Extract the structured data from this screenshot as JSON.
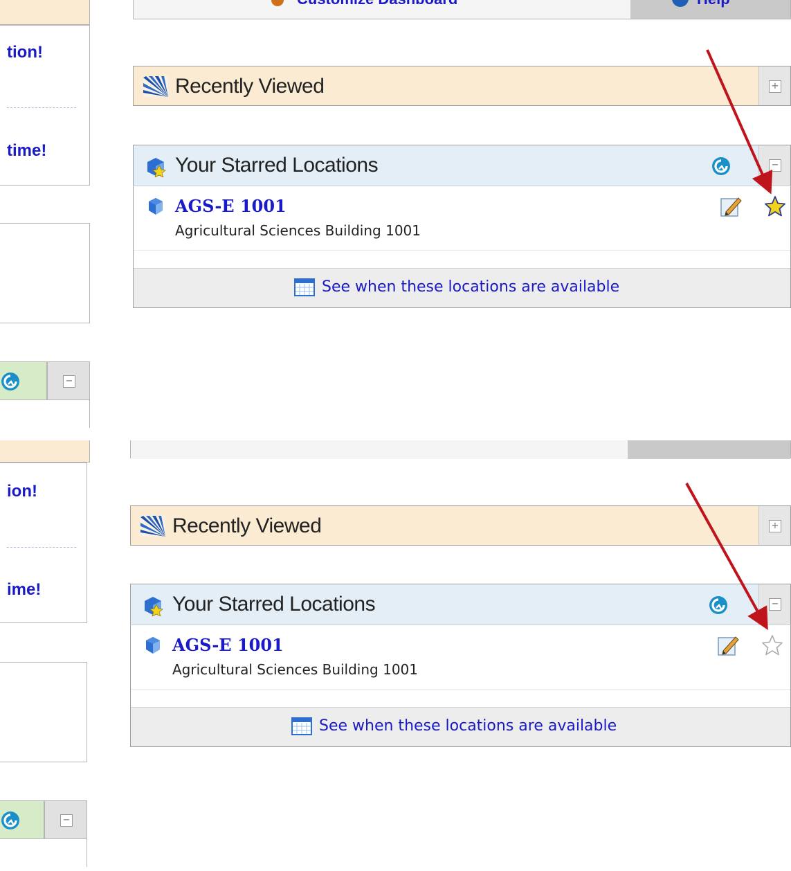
{
  "panels": [
    {
      "id": "before",
      "sidebar": {
        "cta_1": "tion!",
        "cta_2": "time!"
      },
      "toolbar": {
        "customize_label": "Customize Dashboard",
        "help_label": "Help"
      },
      "recently_viewed": {
        "title": "Recently Viewed",
        "toggle": "+"
      },
      "starred": {
        "title": "Your Starred Locations",
        "toggle": "−",
        "items": [
          {
            "name": "AGS-E 1001",
            "description": "Agricultural Sciences Building 1001",
            "starred": true
          }
        ],
        "availability_link": "See when these locations are available"
      },
      "annotation": "arrow pointing to filled star"
    },
    {
      "id": "after",
      "sidebar": {
        "cta_1": "ion!",
        "cta_2": "ime!"
      },
      "recently_viewed": {
        "title": "Recently Viewed",
        "toggle": "+"
      },
      "starred": {
        "title": "Your Starred Locations",
        "toggle": "−",
        "items": [
          {
            "name": "AGS-E 1001",
            "description": "Agricultural Sciences Building 1001",
            "starred": false
          }
        ],
        "availability_link": "See when these locations are available"
      },
      "annotation": "arrow pointing to empty star"
    }
  ],
  "colors": {
    "link": "#1a1ac6",
    "recently_viewed_header": "#fbebd2",
    "starred_header": "#e4eef6",
    "arrow": "#c0141c",
    "star_filled": "#f2d21b"
  },
  "icons": [
    "sunburst-icon",
    "starred-cube-icon",
    "refresh-icon",
    "cube-icon",
    "edit-icon",
    "star-icon",
    "calendar-icon",
    "plus-box-icon",
    "minus-box-icon"
  ]
}
